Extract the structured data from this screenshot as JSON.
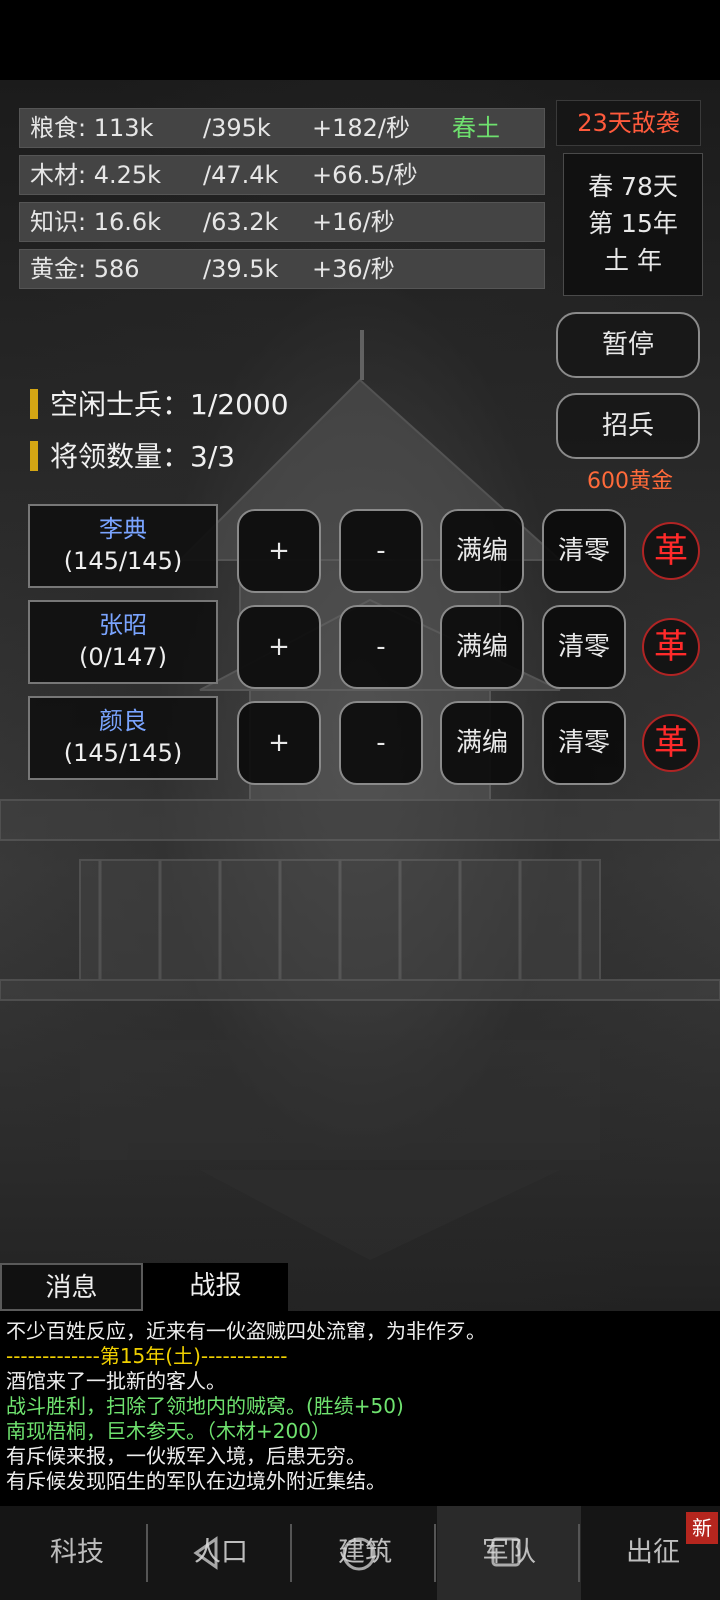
{
  "resources": [
    {
      "name": "粮食: 113k",
      "cap": "/395k",
      "rate": "+182/秒",
      "season": "春土"
    },
    {
      "name": "木材: 4.25k",
      "cap": "/47.4k",
      "rate": "+66.5/秒"
    },
    {
      "name": "知识: 16.6k",
      "cap": "/63.2k",
      "rate": "+16/秒"
    },
    {
      "name": "黄金: 586",
      "cap": "/39.5k",
      "rate": "+36/秒"
    }
  ],
  "alert": "23天敌袭",
  "date": {
    "line1": "春 78天",
    "line2": "第 15年",
    "line3": "土 年"
  },
  "buttons": {
    "pause": "暂停",
    "recruit": "招兵",
    "recruit_cost": "600黄金"
  },
  "stats": {
    "idle_soldiers": "空闲士兵：1/2000",
    "generals": "将领数量：3/3"
  },
  "generals": [
    {
      "name": "李典",
      "count": "(145/145)"
    },
    {
      "name": "张昭",
      "count": "(0/147)"
    },
    {
      "name": "颜良",
      "count": "(145/145)"
    }
  ],
  "general_actions": {
    "add": "+",
    "remove": "-",
    "fill": "满编",
    "clear": "清零",
    "dismiss": "革"
  },
  "log_tabs": {
    "messages": "消息",
    "battle": "战报"
  },
  "log": [
    {
      "text": "不少百姓反应，近来有一伙盗贼四处流窜，为非作歹。",
      "color": "w"
    },
    {
      "text": "-------------第15年(土)------------",
      "color": "y"
    },
    {
      "text": "酒馆来了一批新的客人。",
      "color": "w"
    },
    {
      "text": "战斗胜利，扫除了领地内的贼窝。(胜绩+50)",
      "color": "g"
    },
    {
      "text": "南现梧桐，巨木参天。（木材+200）",
      "color": "g"
    },
    {
      "text": "有斥候来报，一伙叛军入境，后患无穷。",
      "color": "w"
    },
    {
      "text": "有斥候发现陌生的军队在边境外附近集结。",
      "color": "w"
    }
  ],
  "nav": {
    "tech": "科技",
    "population": "人口",
    "building": "建筑",
    "army": "军队",
    "expedition": "出征",
    "new_badge": "新"
  }
}
